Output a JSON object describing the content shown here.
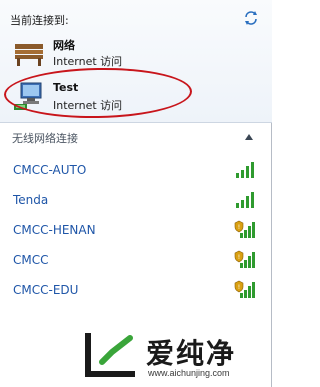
{
  "header": {
    "label": "当前连接到:"
  },
  "connections": [
    {
      "name": "网络",
      "status": "Internet 访问",
      "icon": "bench-icon"
    },
    {
      "name": "Test",
      "status": "Internet 访问",
      "icon": "network-computer-icon"
    }
  ],
  "wireless": {
    "section_label": "无线网络连接",
    "networks": [
      {
        "ssid": "CMCC-AUTO",
        "secured": false
      },
      {
        "ssid": "Tenda",
        "secured": false
      },
      {
        "ssid": "CMCC-HENAN",
        "secured": true
      },
      {
        "ssid": "CMCC",
        "secured": true
      },
      {
        "ssid": "CMCC-EDU",
        "secured": true
      }
    ]
  },
  "watermark": {
    "title": "爱纯净",
    "url": "www.aichunjing.com"
  },
  "colors": {
    "link": "#1f56a8",
    "annotation": "#c8151b",
    "signal": "#2f9b2f",
    "shield": "#d9a012"
  }
}
